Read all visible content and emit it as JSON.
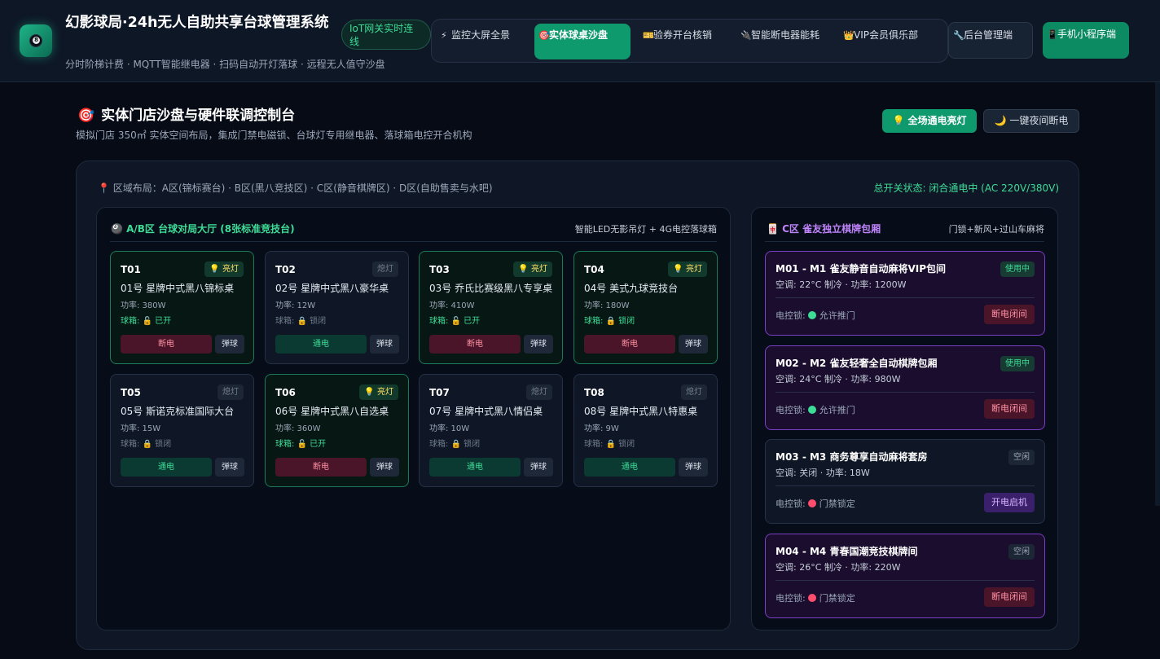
{
  "header": {
    "title": "幻影球局·24h无人自助共享台球管理系统",
    "subtitle": "分时阶梯计费 · MQTT智能继电器 · 扫码自动开灯落球 · 远程无人值守沙盘",
    "iot_badge": "IoT网关实时连线",
    "nav": [
      {
        "icon": "⚡",
        "label": "监控大屏全景"
      },
      {
        "icon": "🎯",
        "label": "实体球桌沙盘"
      },
      {
        "icon": "🎫",
        "label": "验券开台核销"
      },
      {
        "icon": "🔌",
        "label": "智能断电器能耗"
      },
      {
        "icon": "👑",
        "label": "VIP会员俱乐部"
      }
    ],
    "admin": {
      "icon": "🔧",
      "label": "后台管理端"
    },
    "mini": {
      "icon": "📱",
      "label": "手机小程序端"
    }
  },
  "page": {
    "title_icon": "🎯",
    "title": "实体门店沙盘与硬件联调控制台",
    "subtitle": "模拟门店 350㎡ 实体空间布局，集成门禁电磁锁、台球灯专用继电器、落球箱电控开合机构",
    "btn_all_on": "💡 全场通电亮灯",
    "btn_night_off": "🌙 一键夜间断电"
  },
  "layout": {
    "area_label": "📍 区域布局：A区(锦标赛台) · B区(黑八竞技区) · C区(静音棋牌区) · D区(自助售卖与水吧)",
    "master_status": "总开关状态: 闭合通电中 (AC 220V/380V)"
  },
  "ab_zone": {
    "title": "🎱 A/B区 台球对局大厅 (8张标准竞技台)",
    "meta": "智能LED无影吊灯 + 4G电控落球箱",
    "tables": [
      {
        "id": "T01",
        "on": true,
        "badge": "💡 亮灯",
        "name": "01号 星牌中式黑八锦标桌",
        "power": "功率: 380W",
        "pocket": "球箱: 🔓 已开",
        "main_btn": "断电",
        "eject": "弹球"
      },
      {
        "id": "T02",
        "on": false,
        "badge": "熄灯",
        "name": "02号 星牌中式黑八豪华桌",
        "power": "功率: 12W",
        "pocket": "球箱: 🔒 锁闭",
        "main_btn": "通电",
        "eject": "弹球"
      },
      {
        "id": "T03",
        "on": true,
        "badge": "💡 亮灯",
        "name": "03号 乔氏比赛级黑八专享桌",
        "power": "功率: 410W",
        "pocket": "球箱: 🔓 已开",
        "main_btn": "断电",
        "eject": "弹球"
      },
      {
        "id": "T04",
        "on": true,
        "badge": "💡 亮灯",
        "name": "04号 美式九球竞技台",
        "power": "功率: 180W",
        "pocket": "球箱: 🔒 锁闭",
        "main_btn": "断电",
        "eject": "弹球"
      },
      {
        "id": "T05",
        "on": false,
        "badge": "熄灯",
        "name": "05号 斯诺克标准国际大台",
        "power": "功率: 15W",
        "pocket": "球箱: 🔒 锁闭",
        "main_btn": "通电",
        "eject": "弹球"
      },
      {
        "id": "T06",
        "on": true,
        "badge": "💡 亮灯",
        "name": "06号 星牌中式黑八自选桌",
        "power": "功率: 360W",
        "pocket": "球箱: 🔓 已开",
        "main_btn": "断电",
        "eject": "弹球"
      },
      {
        "id": "T07",
        "on": false,
        "badge": "熄灯",
        "name": "07号 星牌中式黑八情侣桌",
        "power": "功率: 10W",
        "pocket": "球箱: 🔒 锁闭",
        "main_btn": "通电",
        "eject": "弹球"
      },
      {
        "id": "T08",
        "on": false,
        "badge": "熄灯",
        "name": "08号 星牌中式黑八特惠桌",
        "power": "功率: 9W",
        "pocket": "球箱: 🔒 锁闭",
        "main_btn": "通电",
        "eject": "弹球"
      }
    ]
  },
  "c_zone": {
    "title": "🀄 C区 雀友独立棋牌包厢",
    "meta": "门锁+新风+过山车麻将",
    "rooms": [
      {
        "title": "M01 - M1 雀友静音自动麻将VIP包间",
        "busy": true,
        "status": "使用中",
        "env": "空调: 22°C 制冷 · 功率: 1200W",
        "lock_label": "电控锁:",
        "lock_open": true,
        "lock_text": "允许推门",
        "btn": "断电闭间"
      },
      {
        "title": "M02 - M2 雀友轻奢全自动棋牌包厢",
        "busy": true,
        "status": "使用中",
        "env": "空调: 24°C 制冷 · 功率: 980W",
        "lock_label": "电控锁:",
        "lock_open": true,
        "lock_text": "允许推门",
        "btn": "断电闭间"
      },
      {
        "title": "M03 - M3 商务尊享自动麻将套房",
        "busy": false,
        "status": "空闲",
        "env": "空调: 关闭 · 功率: 18W",
        "lock_label": "电控锁:",
        "lock_open": false,
        "lock_text": "门禁锁定",
        "btn": "开电启机"
      },
      {
        "title": "M04 - M4 青春国潮竞技棋牌间",
        "busy": false,
        "status": "空闲",
        "env": "空调: 26°C 制冷 · 功率: 220W",
        "lock_label": "电控锁:",
        "lock_open": false,
        "lock_text": "门禁锁定",
        "btn": "断电闭间"
      }
    ]
  },
  "colors": {
    "accent": "#0f9a6e",
    "on_text": "#3ddc97",
    "danger": "#ff8fa3",
    "room_busy_border": "#7b3fc4"
  }
}
